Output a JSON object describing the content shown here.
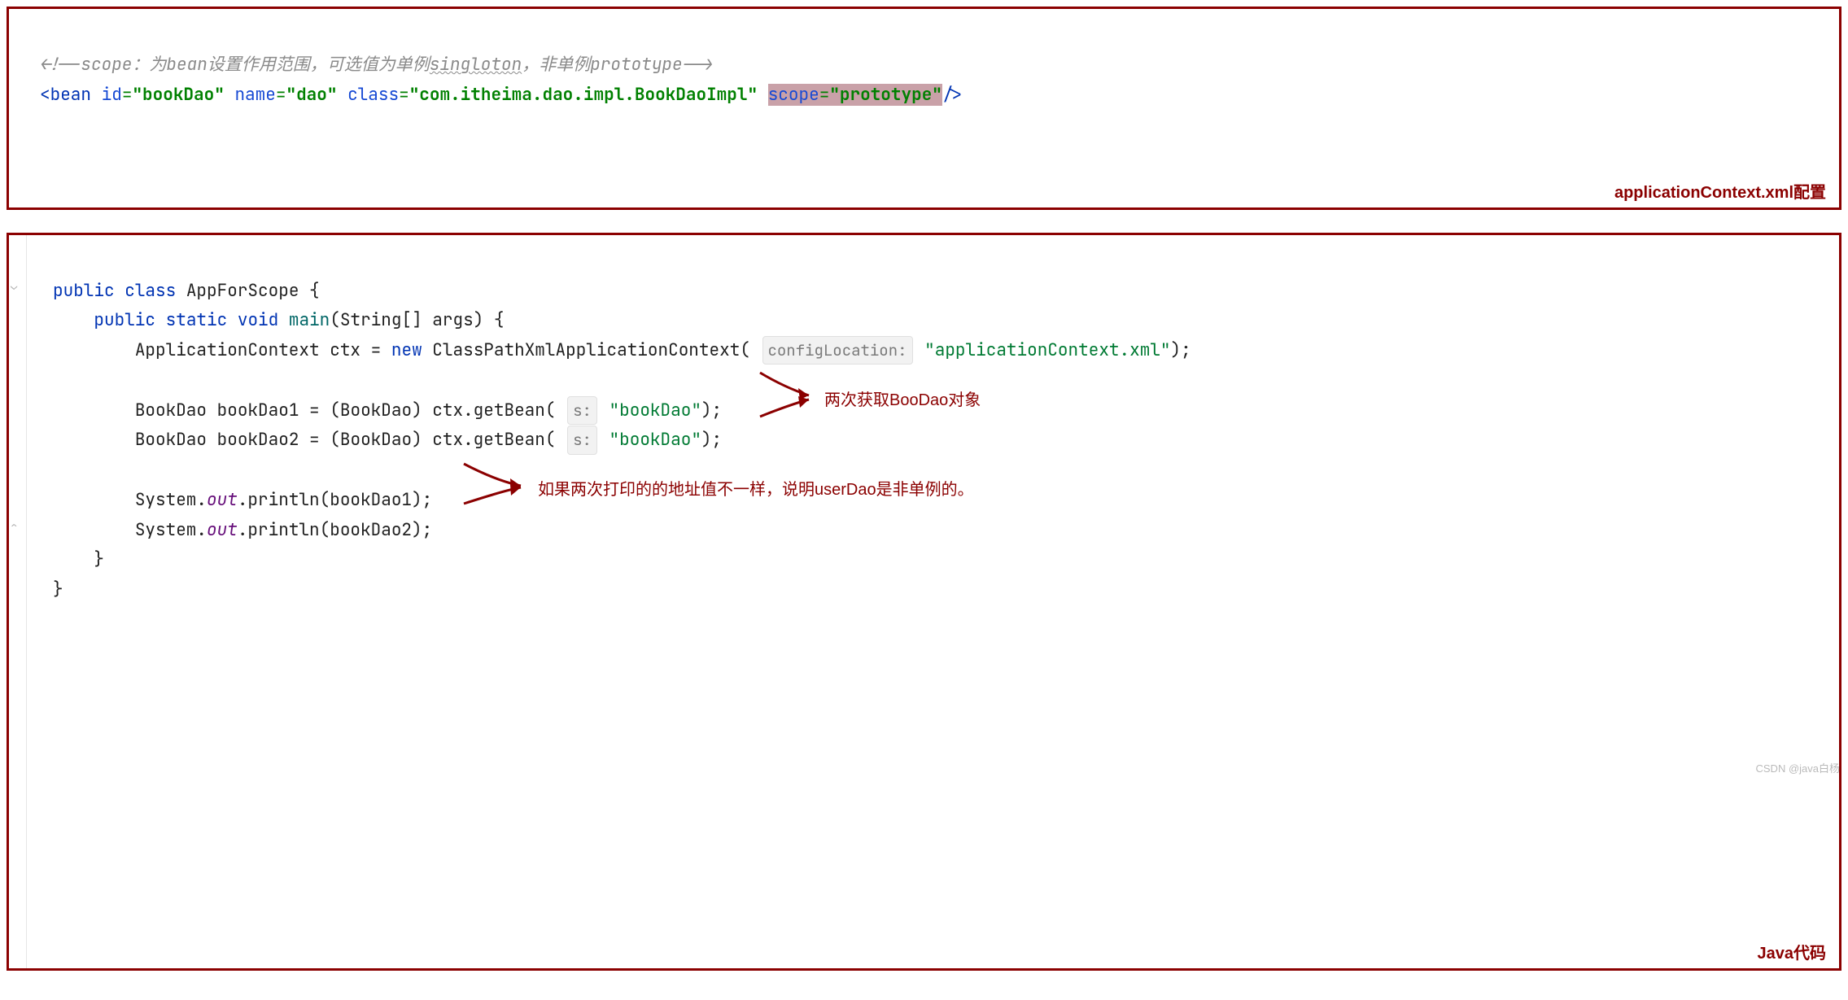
{
  "panel1": {
    "label": "applicationContext.xml配置",
    "comment_open": "<!--",
    "comment_text1": "scope：为bean设置作用范围，可选值为单例",
    "comment_wave": "singloton",
    "comment_text2": "，非单例prototype",
    "comment_close": "-->",
    "lt": "<",
    "tag": "bean",
    "attr_id": "id",
    "eq": "=",
    "val_id": "\"bookDao\"",
    "attr_name": "name",
    "val_name": "\"dao\"",
    "attr_class": "class",
    "val_class": "\"com.itheima.dao.impl.BookDaoImpl\"",
    "attr_scope": "scope",
    "val_scope": "\"prototype\"",
    "close": "/>"
  },
  "panel2": {
    "label": "Java代码",
    "kw_public1": "public",
    "kw_class": "class",
    "cls_name": "AppForScope",
    "brace_open": "{",
    "kw_public2": "public",
    "kw_static": "static",
    "kw_void": "void",
    "fn_main": "main",
    "paren_open": "(",
    "type_string_arr": "String[] args",
    "paren_close": ")",
    "brace_open2": "{",
    "type_appctx": "ApplicationContext",
    "var_ctx": "ctx",
    "assign": "=",
    "kw_new": "new",
    "type_cpxac": "ClassPathXmlApplicationContext",
    "hint_config": "configLocation:",
    "str_appctx": "\"applicationContext.xml\"",
    "semi": ");",
    "type_bookdao": "BookDao",
    "var_bd1": "bookDao1",
    "cast": "(BookDao)",
    "ctx_get": "ctx.getBean(",
    "hint_s": "s:",
    "str_bd": "\"bookDao\"",
    "close_call": ");",
    "var_bd2": "bookDao2",
    "sys": "System.",
    "out": "out",
    "println1": ".println(bookDao1);",
    "println2": ".println(bookDao2);",
    "brace_close1": "}",
    "brace_close2": "}",
    "annot1": "两次获取BooDao对象",
    "annot2": "如果两次打印的的地址值不一样，说明userDao是非单例的。"
  },
  "watermark": "CSDN @java白杨"
}
